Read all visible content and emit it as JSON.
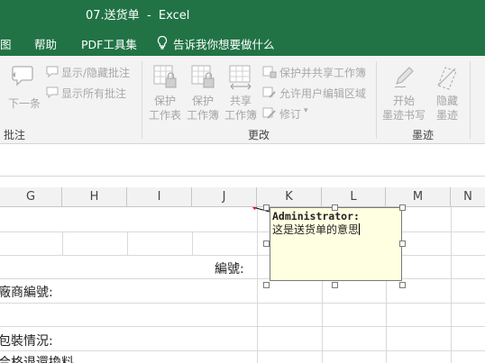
{
  "window": {
    "title": "07.送货单  -  Excel"
  },
  "menu": {
    "items": [
      "图",
      "帮助",
      "PDF工具集"
    ],
    "tell_me": "告诉我你想要做什么"
  },
  "ribbon": {
    "comments": {
      "next": "下一条",
      "show_hide": "显示/隐藏批注",
      "show_all": "显示所有批注",
      "group_label": "批注"
    },
    "changes": {
      "protect_sheet": [
        "保护",
        "工作表"
      ],
      "protect_workbook": [
        "保护",
        "工作簿"
      ],
      "share_workbook": [
        "共享",
        "工作簿"
      ],
      "protect_share": "保护并共享工作簿",
      "allow_edit": "允许用户编辑区域",
      "track": "修订",
      "group_label": "更改"
    },
    "ink": {
      "start": [
        "开始",
        "墨迹书写"
      ],
      "hide": [
        "隐藏",
        "墨迹"
      ],
      "group_label": "墨迹"
    }
  },
  "sheet": {
    "columns": [
      "G",
      "H",
      "I",
      "J",
      "K",
      "L",
      "M",
      "N"
    ],
    "cells": {
      "number_label": "編號:",
      "vendor_label": "廠商編號:",
      "packing_label": "包裝情況:",
      "partial_row": "合格退還換料"
    }
  },
  "comment": {
    "author": "Administrator:",
    "text": "这是送货单的意思"
  },
  "colors": {
    "accent": "#217346",
    "comment_bg": "#ffffe1"
  }
}
